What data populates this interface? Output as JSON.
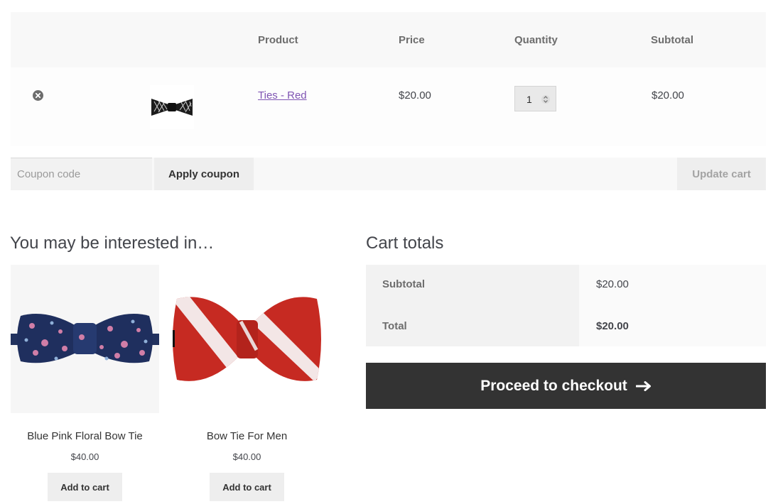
{
  "cart": {
    "headers": {
      "product": "Product",
      "price": "Price",
      "quantity": "Quantity",
      "subtotal": "Subtotal"
    },
    "item": {
      "name": "Ties - Red",
      "price": "$20.00",
      "quantity": "1",
      "subtotal": "$20.00",
      "image_icon": "black-bow-tie-thumbnail"
    }
  },
  "actions": {
    "coupon_placeholder": "Coupon code",
    "apply_label": "Apply coupon",
    "update_label": "Update cart"
  },
  "cross_sells": {
    "title": "You may be interested in…",
    "products": [
      {
        "name": "Blue Pink Floral Bow Tie",
        "price": "$40.00",
        "button": "Add to cart"
      },
      {
        "name": "Bow Tie For Men",
        "price": "$40.00",
        "button": "Add to cart"
      }
    ]
  },
  "totals": {
    "title": "Cart totals",
    "subtotal_label": "Subtotal",
    "subtotal_value": "$20.00",
    "total_label": "Total",
    "total_value": "$20.00"
  },
  "checkout": {
    "label": "Proceed to checkout",
    "icon": "arrow-right-icon"
  },
  "colors": {
    "link": "#7f54b3",
    "checkout_bg": "#333333",
    "floral_navy": "#1f2f5e",
    "stripe_red": "#c62a22"
  }
}
